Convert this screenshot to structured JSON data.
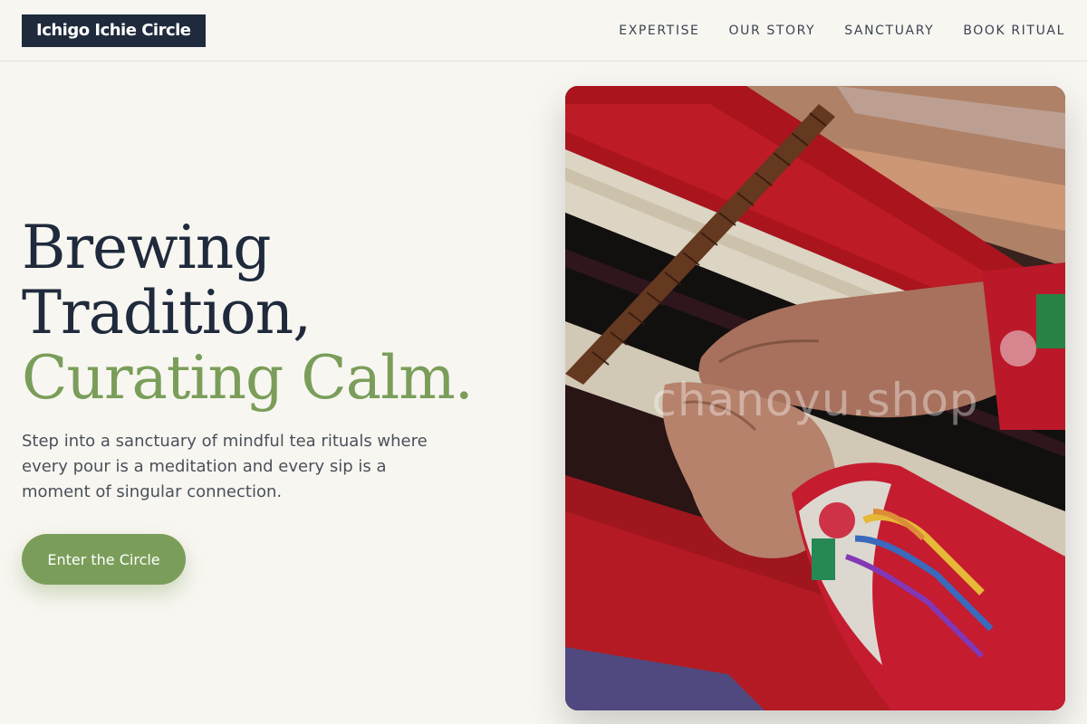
{
  "header": {
    "logo": "Ichigo Ichie Circle",
    "nav": [
      "EXPERTISE",
      "OUR STORY",
      "SANCTUARY",
      "BOOK RITUAL"
    ]
  },
  "hero": {
    "headline_line1": "Brewing",
    "headline_line2": "Tradition,",
    "headline_accent": "Curating Calm.",
    "lead": "Step into a sanctuary of mindful tea rituals where every pour is a meditation and every sip is a moment of singular connection.",
    "cta": "Enter the Circle",
    "image_watermark": "chanoyu.shop"
  },
  "colors": {
    "background": "#f8f6f1",
    "navy": "#1f2a3c",
    "accent_green": "#7a9e5a",
    "body_text": "#4a505a"
  }
}
